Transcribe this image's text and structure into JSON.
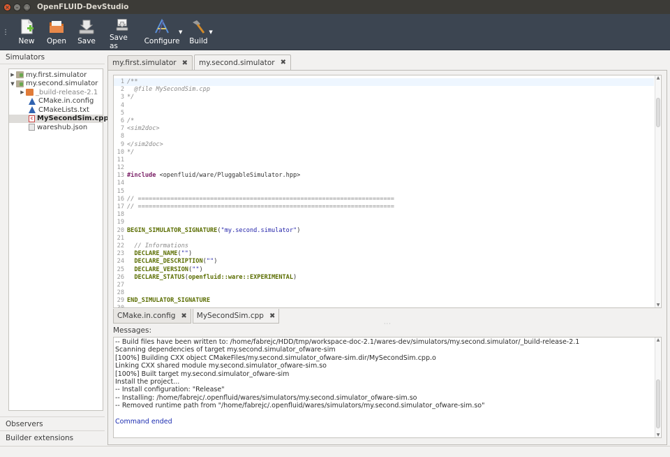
{
  "window": {
    "title": "OpenFLUID-DevStudio",
    "buttons": {
      "close": "×",
      "minimize": "–",
      "maximize": "□"
    }
  },
  "toolbar": {
    "items": [
      {
        "label": "New",
        "icon": "new-file-icon"
      },
      {
        "label": "Open",
        "icon": "open-folder-icon"
      },
      {
        "label": "Save",
        "icon": "save-icon"
      },
      {
        "label": "Save as",
        "icon": "save-as-icon"
      },
      {
        "label": "Configure",
        "icon": "configure-icon"
      },
      {
        "label": "Build",
        "icon": "build-hammer-icon"
      }
    ]
  },
  "left_panel": {
    "header": "Simulators",
    "tree": [
      {
        "label": "my.first.simulator",
        "depth": 0,
        "arrow": "▶",
        "icon": "folder"
      },
      {
        "label": "my.second.simulator",
        "depth": 0,
        "arrow": "▼",
        "icon": "folder"
      },
      {
        "label": "_build-release-2.1",
        "depth": 1,
        "arrow": "▶",
        "icon": "folder-orange",
        "muted": true
      },
      {
        "label": "CMake.in.config",
        "depth": 1,
        "arrow": "",
        "icon": "cmake"
      },
      {
        "label": "CMakeLists.txt",
        "depth": 1,
        "arrow": "",
        "icon": "cmake"
      },
      {
        "label": "MySecondSim.cpp",
        "depth": 1,
        "arrow": "",
        "icon": "cpp",
        "selected": true
      },
      {
        "label": "wareshub.json",
        "depth": 1,
        "arrow": "",
        "icon": "doc"
      }
    ],
    "sections": [
      "Observers",
      "Builder extensions"
    ]
  },
  "editor": {
    "tabs": [
      {
        "label": "my.first.simulator",
        "active": false
      },
      {
        "label": "my.second.simulator",
        "active": true
      }
    ],
    "close_glyph": "✖",
    "code_lines": [
      {
        "n": "1",
        "parts": [
          [
            "cmt",
            "/**"
          ]
        ]
      },
      {
        "n": "2",
        "parts": [
          [
            "cmt",
            "  @file MySecondSim.cpp"
          ]
        ]
      },
      {
        "n": "3",
        "parts": [
          [
            "cmt",
            "*/"
          ]
        ]
      },
      {
        "n": "4",
        "parts": []
      },
      {
        "n": "5",
        "parts": []
      },
      {
        "n": "6",
        "parts": [
          [
            "cmt",
            "/*"
          ]
        ]
      },
      {
        "n": "7",
        "parts": [
          [
            "cmt",
            "<sim2doc>"
          ]
        ]
      },
      {
        "n": "8",
        "parts": []
      },
      {
        "n": "9",
        "parts": [
          [
            "cmt",
            "</sim2doc>"
          ]
        ]
      },
      {
        "n": "10",
        "parts": [
          [
            "cmt",
            "*/"
          ]
        ]
      },
      {
        "n": "11",
        "parts": []
      },
      {
        "n": "12",
        "parts": []
      },
      {
        "n": "13",
        "parts": [
          [
            "kw",
            "#include"
          ],
          [
            "inc",
            " <openfluid/ware/PluggableSimulator.hpp>"
          ]
        ]
      },
      {
        "n": "14",
        "parts": []
      },
      {
        "n": "15",
        "parts": []
      },
      {
        "n": "16",
        "parts": [
          [
            "cmt",
            "// ======================================================================="
          ]
        ]
      },
      {
        "n": "17",
        "parts": [
          [
            "cmt",
            "// ======================================================================="
          ]
        ]
      },
      {
        "n": "18",
        "parts": []
      },
      {
        "n": "19",
        "parts": []
      },
      {
        "n": "20",
        "parts": [
          [
            "mac",
            "BEGIN_SIMULATOR_SIGNATURE"
          ],
          [
            "inc",
            "("
          ],
          [
            "str",
            "\"my.second.simulator\""
          ],
          [
            "inc",
            ")"
          ]
        ]
      },
      {
        "n": "21",
        "parts": []
      },
      {
        "n": "22",
        "parts": [
          [
            "cmt",
            "  // Informations"
          ]
        ]
      },
      {
        "n": "23",
        "parts": [
          [
            "mac",
            "  DECLARE_NAME"
          ],
          [
            "inc",
            "("
          ],
          [
            "str",
            "\"\""
          ],
          [
            "inc",
            ")"
          ]
        ]
      },
      {
        "n": "24",
        "parts": [
          [
            "mac",
            "  DECLARE_DESCRIPTION"
          ],
          [
            "inc",
            "("
          ],
          [
            "str",
            "\"\""
          ],
          [
            "inc",
            ")"
          ]
        ]
      },
      {
        "n": "25",
        "parts": [
          [
            "mac",
            "  DECLARE_VERSION"
          ],
          [
            "inc",
            "("
          ],
          [
            "str",
            "\"\""
          ],
          [
            "inc",
            ")"
          ]
        ]
      },
      {
        "n": "26",
        "parts": [
          [
            "mac",
            "  DECLARE_STATUS"
          ],
          [
            "inc",
            "("
          ],
          [
            "mac",
            "openfluid::ware::EXPERIMENTAL"
          ],
          [
            "inc",
            ")"
          ]
        ]
      },
      {
        "n": "27",
        "parts": []
      },
      {
        "n": "28",
        "parts": []
      },
      {
        "n": "29",
        "parts": [
          [
            "mac",
            "END_SIMULATOR_SIGNATURE"
          ]
        ]
      },
      {
        "n": "30",
        "parts": []
      }
    ],
    "subtabs": [
      {
        "label": "CMake.in.config",
        "active": false
      },
      {
        "label": "MySecondSim.cpp",
        "active": true
      }
    ]
  },
  "messages": {
    "label": "Messages:",
    "lines": [
      "-- Build files have been written to: /home/fabrejc/HDD/tmp/workspace-doc-2.1/wares-dev/simulators/my.second.simulator/_build-release-2.1",
      "Scanning dependencies of target my.second.simulator_ofware-sim",
      "[100%] Building CXX object CMakeFiles/my.second.simulator_ofware-sim.dir/MySecondSim.cpp.o",
      "Linking CXX shared module my.second.simulator_ofware-sim.so",
      "[100%] Built target my.second.simulator_ofware-sim",
      "Install the project...",
      "-- Install configuration: \"Release\"",
      "-- Installing: /home/fabrejc/.openfluid/wares/simulators/my.second.simulator_ofware-sim.so",
      "-- Removed runtime path from \"/home/fabrejc/.openfluid/wares/simulators/my.second.simulator_ofware-sim.so\"",
      ""
    ],
    "final_line": "Command ended"
  }
}
